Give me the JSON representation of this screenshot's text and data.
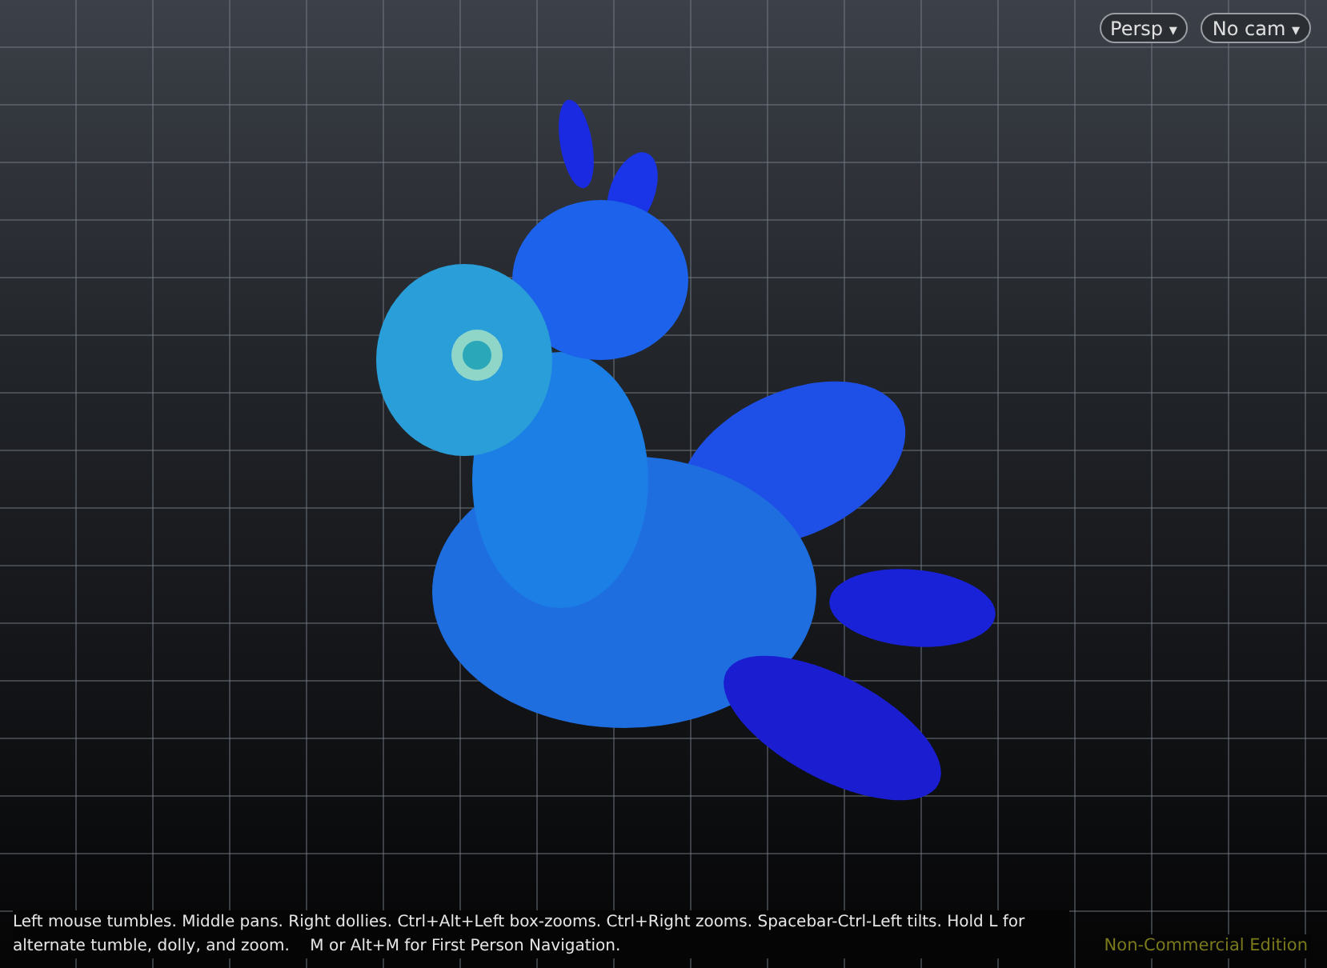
{
  "viewport_menus": [
    {
      "label": "Persp",
      "caret": "▾"
    },
    {
      "label": "No cam",
      "caret": "▾"
    }
  ],
  "help_text": "Left mouse tumbles. Middle pans. Right dollies. Ctrl+Alt+Left box-zooms. Ctrl+Right zooms. Spacebar-Ctrl-Left tilts. Hold L for alternate tumble, dolly, and zoom.    M or Alt+M for First Person Navigation.",
  "edition_label": "Non-Commercial Edition"
}
